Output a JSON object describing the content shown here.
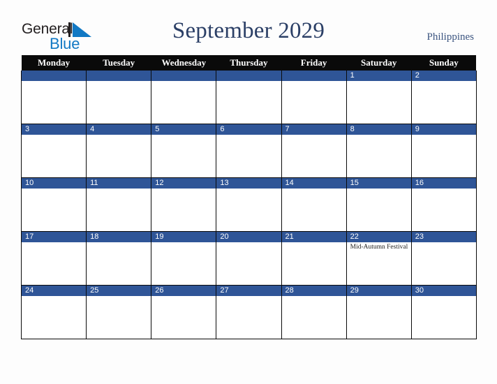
{
  "brand": {
    "name_part1": "General",
    "name_part2": "Blue",
    "mark": "triangle-logo-icon",
    "color_dark": "#231f20",
    "color_blue": "#1279c4"
  },
  "header": {
    "title": "September 2029",
    "country": "Philippines",
    "title_color": "#2b3f66"
  },
  "calendar": {
    "accent_color": "#2f5597",
    "header_bg": "#0a0a0a",
    "weekday_headers": [
      "Monday",
      "Tuesday",
      "Wednesday",
      "Thursday",
      "Friday",
      "Saturday",
      "Sunday"
    ],
    "weeks": [
      [
        {
          "date": "",
          "events": []
        },
        {
          "date": "",
          "events": []
        },
        {
          "date": "",
          "events": []
        },
        {
          "date": "",
          "events": []
        },
        {
          "date": "",
          "events": []
        },
        {
          "date": "1",
          "events": []
        },
        {
          "date": "2",
          "events": []
        }
      ],
      [
        {
          "date": "3",
          "events": []
        },
        {
          "date": "4",
          "events": []
        },
        {
          "date": "5",
          "events": []
        },
        {
          "date": "6",
          "events": []
        },
        {
          "date": "7",
          "events": []
        },
        {
          "date": "8",
          "events": []
        },
        {
          "date": "9",
          "events": []
        }
      ],
      [
        {
          "date": "10",
          "events": []
        },
        {
          "date": "11",
          "events": []
        },
        {
          "date": "12",
          "events": []
        },
        {
          "date": "13",
          "events": []
        },
        {
          "date": "14",
          "events": []
        },
        {
          "date": "15",
          "events": []
        },
        {
          "date": "16",
          "events": []
        }
      ],
      [
        {
          "date": "17",
          "events": []
        },
        {
          "date": "18",
          "events": []
        },
        {
          "date": "19",
          "events": []
        },
        {
          "date": "20",
          "events": []
        },
        {
          "date": "21",
          "events": []
        },
        {
          "date": "22",
          "events": [
            "Mid-Autumn Festival"
          ]
        },
        {
          "date": "23",
          "events": []
        }
      ],
      [
        {
          "date": "24",
          "events": []
        },
        {
          "date": "25",
          "events": []
        },
        {
          "date": "26",
          "events": []
        },
        {
          "date": "27",
          "events": []
        },
        {
          "date": "28",
          "events": []
        },
        {
          "date": "29",
          "events": []
        },
        {
          "date": "30",
          "events": []
        }
      ]
    ]
  }
}
